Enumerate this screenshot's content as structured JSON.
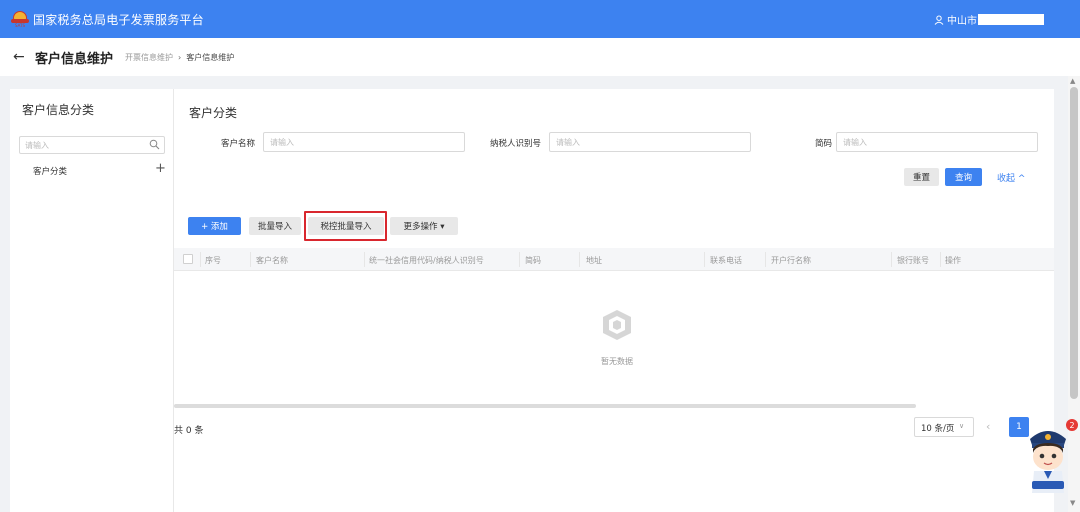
{
  "header": {
    "system_title": "国家税务总局电子发票服务平台",
    "user_prefix": "中山市"
  },
  "page": {
    "title": "客户信息维护",
    "breadcrumb": [
      "开票信息维护",
      "客户信息维护"
    ],
    "breadcrumb_sep": "›"
  },
  "sidebar": {
    "title": "客户信息分类",
    "search_placeholder": "请输入",
    "items": [
      {
        "label": "客户分类"
      }
    ],
    "add_symbol": "+"
  },
  "filter": {
    "section_title": "客户分类",
    "fields": [
      {
        "label": "客户名称",
        "placeholder": "请输入"
      },
      {
        "label": "纳税人识别号",
        "placeholder": "请输入"
      },
      {
        "label": "简码",
        "placeholder": "请输入"
      }
    ],
    "reset_label": "重置",
    "query_label": "查询",
    "collapse_label": "收起 ^"
  },
  "toolbar": {
    "add_label": "+ 添加",
    "batch_import_label": "批量导入",
    "tax_batch_import_label": "税控批量导入",
    "more_label": "更多操作 ▾"
  },
  "table": {
    "columns": [
      "序号",
      "客户名称",
      "统一社会信用代码/纳税人识别号",
      "简码",
      "地址",
      "联系电话",
      "开户行名称",
      "银行账号",
      "操作"
    ],
    "empty_text": "暂无数据"
  },
  "pagination": {
    "total_text": "共 0 条",
    "page_size": "10 条/页",
    "current_page": "1",
    "notification_count": "2"
  },
  "colors": {
    "primary": "#3d82f0",
    "highlight_border": "#d9272e"
  }
}
